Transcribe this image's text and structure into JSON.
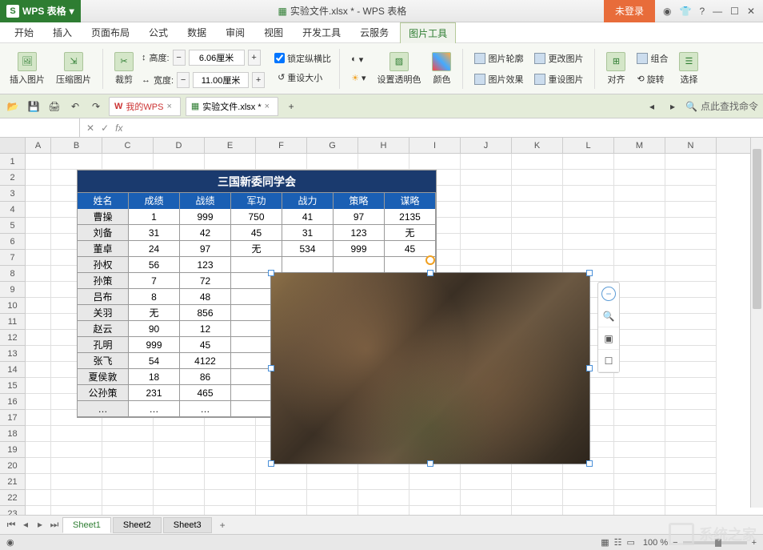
{
  "app": {
    "name": "WPS 表格",
    "doc_title": "实验文件.xlsx * - WPS 表格",
    "login": "未登录"
  },
  "menu": {
    "tabs": [
      "开始",
      "插入",
      "页面布局",
      "公式",
      "数据",
      "审阅",
      "视图",
      "开发工具",
      "云服务",
      "图片工具"
    ],
    "active_index": 9
  },
  "ribbon": {
    "insert_pic": "插入图片",
    "compress": "压缩图片",
    "crop": "裁剪",
    "height_lbl": "高度:",
    "height_val": "6.06厘米",
    "width_lbl": "宽度:",
    "width_val": "11.00厘米",
    "lock_ratio": "锁定纵横比",
    "reset_size": "重设大小",
    "set_trans": "设置透明色",
    "color": "颜色",
    "outline": "图片轮廓",
    "effect": "图片效果",
    "change": "更改图片",
    "reset_pic": "重设图片",
    "align": "对齐",
    "rotate": "旋转",
    "group": "组合",
    "select": "选择"
  },
  "quick": {
    "my_wps": "我的WPS",
    "doc_tab": "实验文件.xlsx *",
    "search_cmd": "点此查找命令"
  },
  "formula": {
    "name_box": "",
    "fx": "fx"
  },
  "grid": {
    "cols": [
      "A",
      "B",
      "C",
      "D",
      "E",
      "F",
      "G",
      "H",
      "I",
      "J",
      "K",
      "L",
      "M",
      "N"
    ],
    "visible_rows": 23
  },
  "table": {
    "title": "三国新委同学会",
    "headers": [
      "姓名",
      "成绩",
      "战绩",
      "军功",
      "战力",
      "策略",
      "谋略"
    ],
    "rows": [
      [
        "曹操",
        "1",
        "999",
        "750",
        "41",
        "97",
        "2135"
      ],
      [
        "刘备",
        "31",
        "42",
        "45",
        "31",
        "123",
        "无"
      ],
      [
        "董卓",
        "24",
        "97",
        "无",
        "534",
        "999",
        "45"
      ],
      [
        "孙权",
        "56",
        "123",
        "",
        "",
        "",
        ""
      ],
      [
        "孙策",
        "7",
        "72",
        "",
        "",
        "",
        ""
      ],
      [
        "吕布",
        "8",
        "48",
        "",
        "",
        "",
        ""
      ],
      [
        "关羽",
        "无",
        "856",
        "",
        "",
        "",
        ""
      ],
      [
        "赵云",
        "90",
        "12",
        "",
        "",
        "",
        ""
      ],
      [
        "孔明",
        "999",
        "45",
        "",
        "",
        "",
        ""
      ],
      [
        "张飞",
        "54",
        "4122",
        "",
        "",
        "",
        ""
      ],
      [
        "夏侯敦",
        "18",
        "86",
        "",
        "",
        "",
        ""
      ],
      [
        "公孙策",
        "231",
        "465",
        "",
        "",
        "",
        ""
      ],
      [
        "…",
        "…",
        "…",
        "",
        "",
        "",
        ""
      ]
    ]
  },
  "sheets": {
    "list": [
      "Sheet1",
      "Sheet2",
      "Sheet3"
    ],
    "active": 0
  },
  "status": {
    "zoom": "100 %"
  },
  "watermark": "系统之家"
}
